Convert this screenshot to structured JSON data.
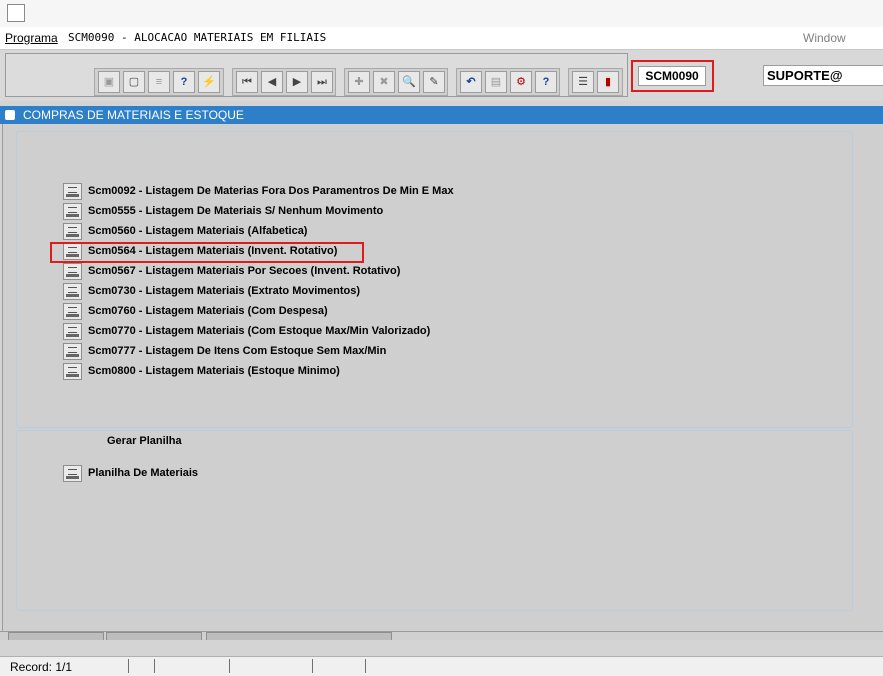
{
  "menubar": {
    "programa": "Programa",
    "title": "SCM0090 - ALOCACAO MATERIAIS EM FILIAIS",
    "window": "Window"
  },
  "toolbar": {
    "program_code": "SCM0090",
    "user": "SUPORTE@"
  },
  "window": {
    "title": "COMPRAS DE MATERIAIS E ESTOQUE"
  },
  "reports": [
    "Scm0092 - Listagem De Materias Fora Dos Paramentros De Min E Max",
    "Scm0555 - Listagem De Materiais S/ Nenhum Movimento",
    "Scm0560 - Listagem Materiais (Alfabetica)",
    "Scm0564 - Listagem Materiais (Invent. Rotativo)",
    "Scm0567 - Listagem Materiais Por Secoes (Invent. Rotativo)",
    "Scm0730 - Listagem Materiais (Extrato Movimentos)",
    "Scm0760 - Listagem Materiais (Com Despesa)",
    "Scm0770 - Listagem Materiais (Com Estoque Max/Min Valorizado)",
    "Scm0777 - Listagem De Itens Com Estoque Sem Max/Min",
    "Scm0800 - Listagem Materiais (Estoque Minimo)"
  ],
  "spreadsheet": {
    "section_label": "Gerar Planilha",
    "item": "Planilha De Materiais"
  },
  "status": {
    "record": "Record: 1/1"
  },
  "colors": {
    "header_blue": "#2e7fc9",
    "highlight_red": "#e01b1b"
  }
}
